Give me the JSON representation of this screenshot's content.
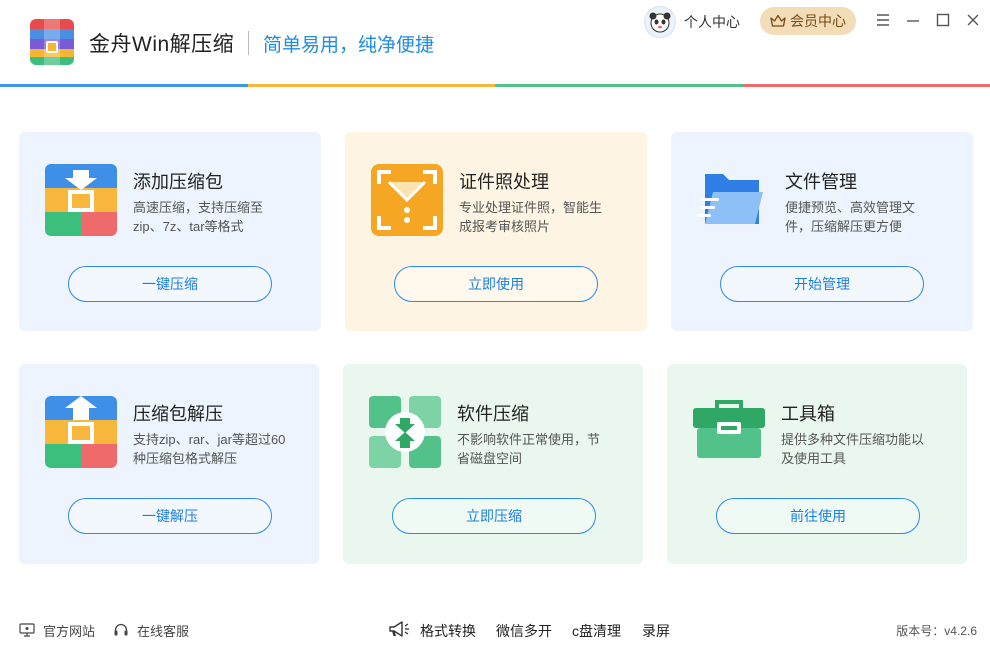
{
  "header": {
    "app_title": "金舟Win解压缩",
    "slogan": "简单易用，纯净便捷",
    "user_center": "个人中心",
    "vip": "会员中心"
  },
  "colors": {
    "accent_blue": "#2e8ae6",
    "line": [
      "#3d96e8",
      "#f6b73c",
      "#52c28a",
      "#ef6a6a"
    ]
  },
  "cards": [
    {
      "title": "添加压缩包",
      "desc": "高速压缩，支持压缩至zip、7z、tar等格式",
      "button": "一键压缩",
      "icon": "zip-add-icon",
      "bg": "#edf4fd"
    },
    {
      "title": "证件照处理",
      "desc": "专业处理证件照，智能生成报考审核照片",
      "button": "立即使用",
      "icon": "id-photo-icon",
      "bg": "#fdf4e3"
    },
    {
      "title": "文件管理",
      "desc": "便捷预览、高效管理文件，压缩解压更方便",
      "button": "开始管理",
      "icon": "folder-icon",
      "bg": "#edf4fd"
    },
    {
      "title": "压缩包解压",
      "desc": "支持zip、rar、jar等超过60种压缩包格式解压",
      "button": "一键解压",
      "icon": "zip-extract-icon",
      "bg": "#edf4fd"
    },
    {
      "title": "软件压缩",
      "desc": "不影响软件正常使用，节省磁盘空间",
      "button": "立即压缩",
      "icon": "software-compress-icon",
      "bg": "#e9f7ef"
    },
    {
      "title": "工具箱",
      "desc": "提供多种文件压缩功能以及使用工具",
      "button": "前往使用",
      "icon": "toolbox-icon",
      "bg": "#e9f7ef"
    }
  ],
  "footer": {
    "website": "官方网站",
    "service": "在线客服",
    "tools": [
      "格式转换",
      "微信多开",
      "c盘清理",
      "录屏"
    ],
    "version": "版本号：v4.2.6"
  }
}
